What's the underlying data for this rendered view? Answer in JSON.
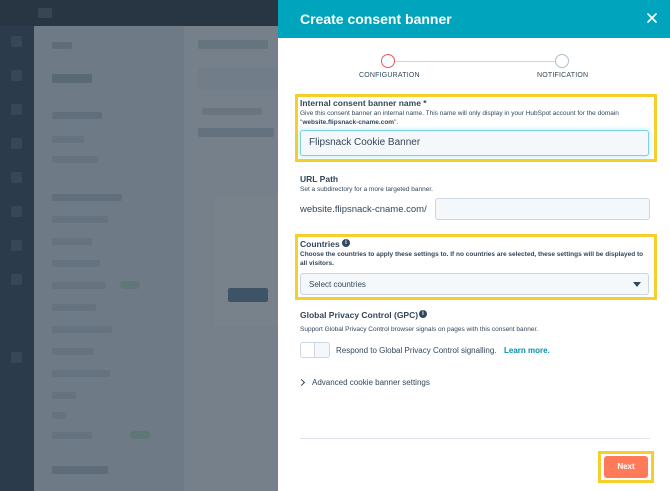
{
  "modal": {
    "title": "Create consent banner",
    "close_icon": "close-icon",
    "steps": [
      {
        "label": "CONFIGURATION",
        "state": "active"
      },
      {
        "label": "NOTIFICATION",
        "state": "inactive"
      }
    ],
    "banner_name": {
      "label": "Internal consent banner name *",
      "help_prefix": "Give this consent banner an internal name. This name will only display in your HubSpot account for the domain \"",
      "help_domain": "website.flipsnack-cname.com",
      "help_suffix": "\".",
      "value": "Flipsnack Cookie Banner"
    },
    "url_path": {
      "label": "URL Path",
      "help": "Set a subdirectory for a more targeted banner.",
      "prefix": "website.flipsnack-cname.com/",
      "value": ""
    },
    "countries": {
      "label": "Countries",
      "help": "Choose the countries to apply these settings to. If no countries are selected, these settings will be displayed to all visitors.",
      "selected": "Select countries"
    },
    "gpc": {
      "label": "Global Privacy Control (GPC)",
      "help": "Support Global Privacy Control browser signals on pages with this consent banner.",
      "toggle_text": "Respond to Global Privacy Control signalling.",
      "link_text": "Learn more.",
      "enabled": false
    },
    "advanced": {
      "label": "Advanced cookie banner settings"
    },
    "next_label": "Next"
  },
  "colors": {
    "header": "#00a4bd",
    "highlight": "#f5d02a",
    "primary_button": "#ff7a59",
    "active_step": "#f2545b",
    "link": "#0091ae"
  }
}
